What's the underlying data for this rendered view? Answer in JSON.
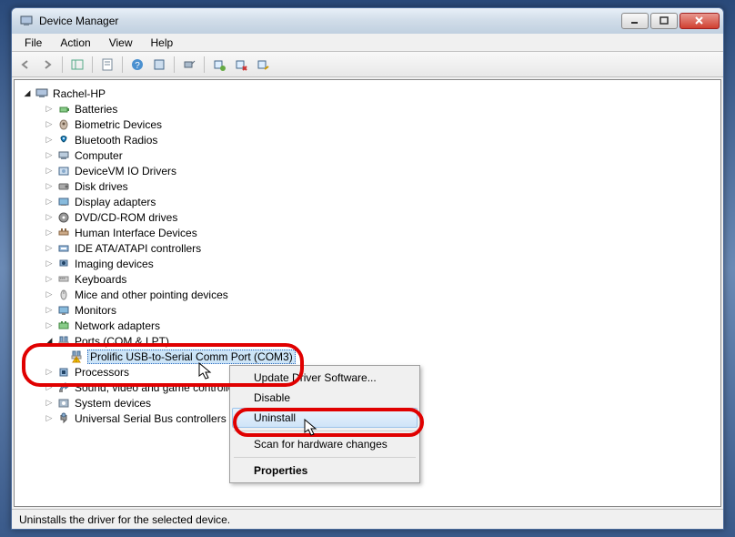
{
  "window_title": "Device Manager",
  "menu": {
    "file": "File",
    "action": "Action",
    "view": "View",
    "help": "Help"
  },
  "root_node": "Rachel-HP",
  "categories": [
    "Batteries",
    "Biometric Devices",
    "Bluetooth Radios",
    "Computer",
    "DeviceVM IO Drivers",
    "Disk drives",
    "Display adapters",
    "DVD/CD-ROM drives",
    "Human Interface Devices",
    "IDE ATA/ATAPI controllers",
    "Imaging devices",
    "Keyboards",
    "Mice and other pointing devices",
    "Monitors",
    "Network adapters"
  ],
  "ports_category": "Ports (COM & LPT)",
  "port_device": "Prolific USB-to-Serial Comm Port (COM3)",
  "categories_after": [
    "Processors",
    "Sound, video and game controllers",
    "System devices",
    "Universal Serial Bus controllers"
  ],
  "context_menu": {
    "update": "Update Driver Software...",
    "disable": "Disable",
    "uninstall": "Uninstall",
    "scan": "Scan for hardware changes",
    "properties": "Properties"
  },
  "statusbar": "Uninstalls the driver for the selected device."
}
